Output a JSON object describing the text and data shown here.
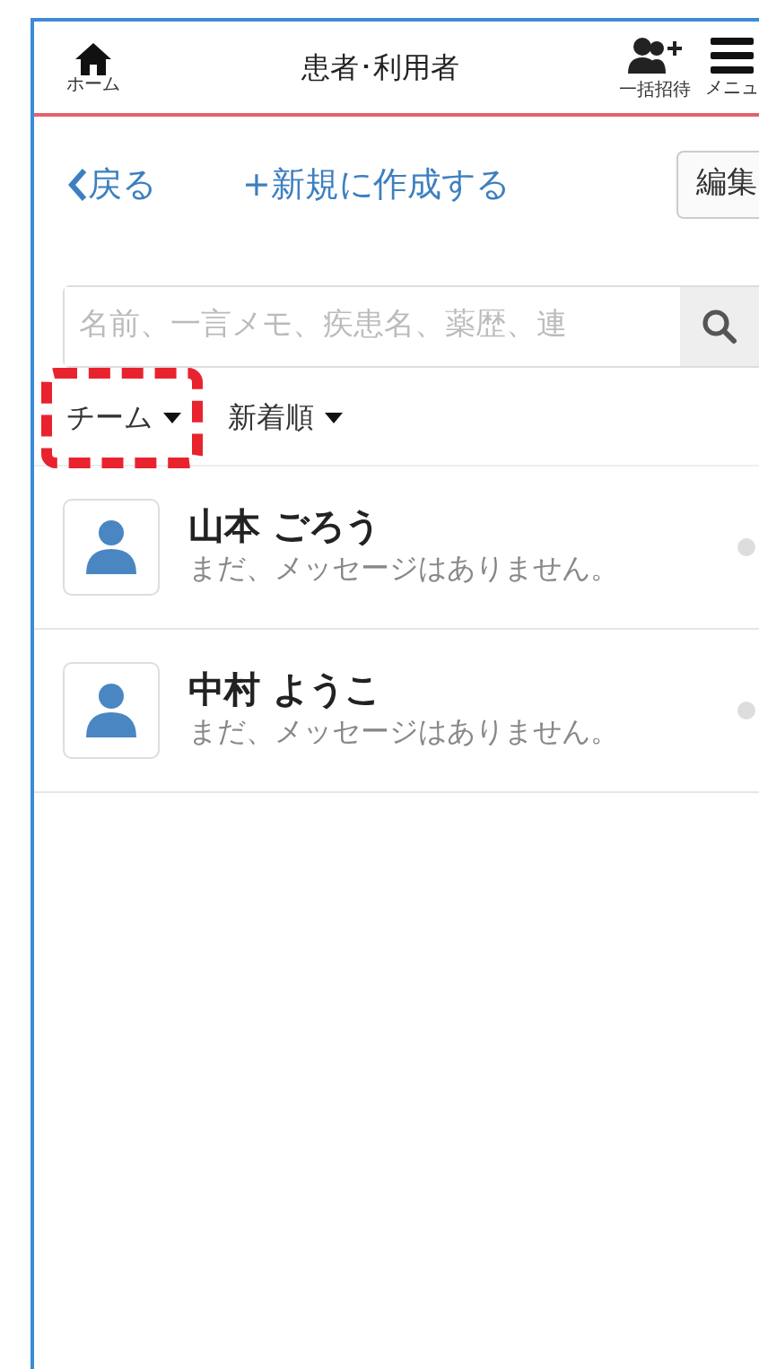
{
  "header": {
    "title": "患者･利用者",
    "home_label": "ホーム",
    "actions": [
      {
        "kind": "invite",
        "label": "一括招待"
      },
      {
        "kind": "menu",
        "label": "メニュ"
      }
    ]
  },
  "toolbar": {
    "back": "戻る",
    "create": "+新規に作成する",
    "edit": "編集"
  },
  "search": {
    "placeholder": "名前、一言メモ、疾患名、薬歴、連"
  },
  "filters": [
    {
      "label": "チーム",
      "highlighted": true
    },
    {
      "label": "新着順",
      "highlighted": false
    }
  ],
  "patients": [
    {
      "name": "山本 ごろう",
      "message": "まだ、メッセージはありません。"
    },
    {
      "name": "中村 ようこ",
      "message": "まだ、メッセージはありません。"
    }
  ]
}
